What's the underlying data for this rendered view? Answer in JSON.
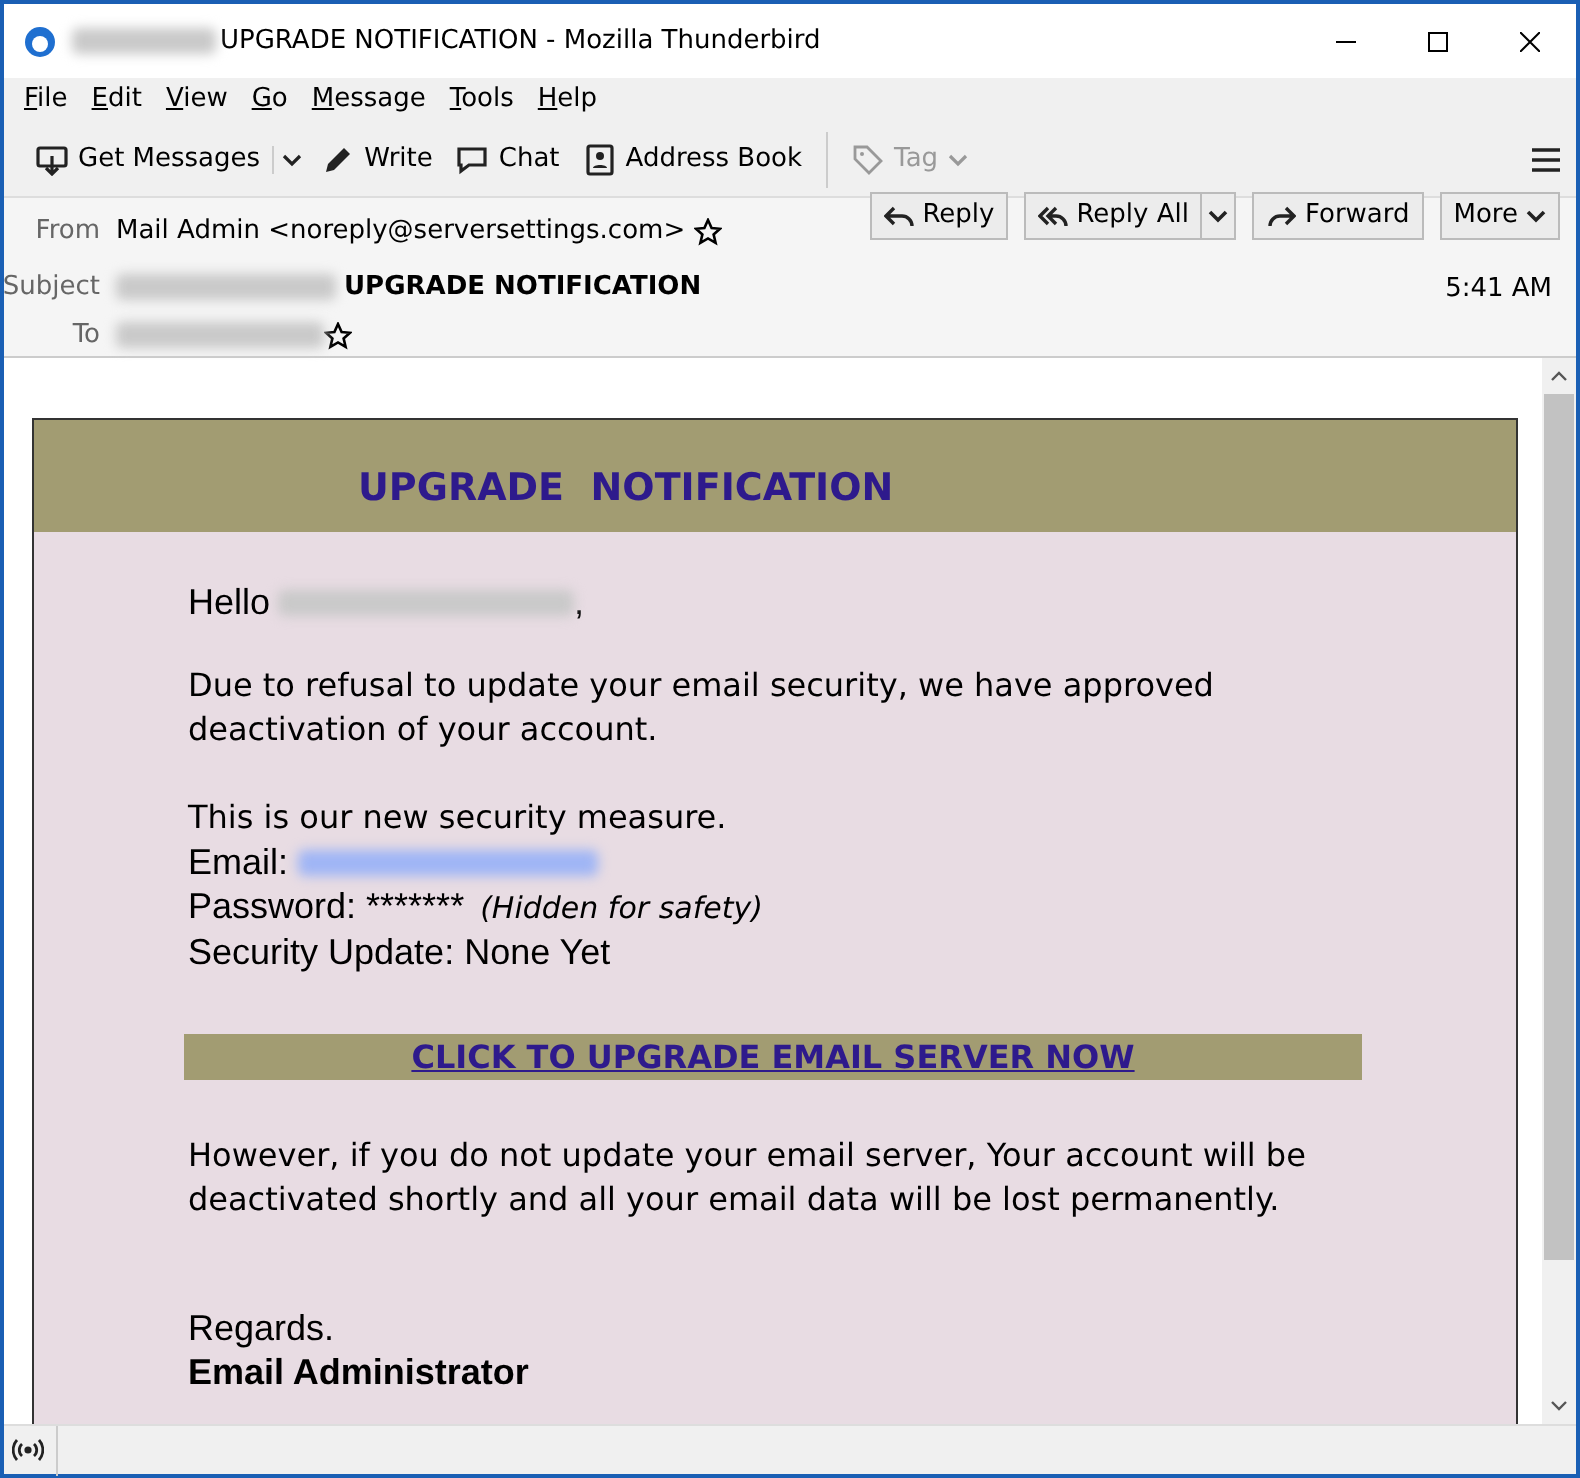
{
  "window": {
    "title": "UPGRADE NOTIFICATION - Mozilla Thunderbird"
  },
  "menu": [
    {
      "label": "File"
    },
    {
      "label": "Edit"
    },
    {
      "label": "View"
    },
    {
      "label": "Go"
    },
    {
      "label": "Message"
    },
    {
      "label": "Tools"
    },
    {
      "label": "Help"
    }
  ],
  "toolbar": [
    {
      "label": "Get Messages",
      "kind": "split",
      "disabled": false
    },
    {
      "label": "Write",
      "kind": "plain",
      "disabled": false
    },
    {
      "label": "Chat",
      "kind": "plain",
      "disabled": false
    },
    {
      "label": "Address Book",
      "kind": "plain",
      "disabled": false
    },
    {
      "label": "Tag",
      "kind": "dropdown",
      "disabled": true
    }
  ],
  "header": {
    "from": {
      "label": "From",
      "value": "Mail Admin <noreply@serversettings.com>"
    },
    "subject": {
      "label": "Subject",
      "value": "UPGRADE NOTIFICATION"
    },
    "to": {
      "label": "To"
    },
    "time": "5:41 AM",
    "actions": [
      {
        "label": "Reply",
        "kind": "plain"
      },
      {
        "label": "Reply All",
        "kind": "split"
      },
      {
        "label": "Forward",
        "kind": "plain"
      },
      {
        "label": "More",
        "kind": "dropdown"
      }
    ]
  },
  "email": {
    "banner_title": "UPGRADE  NOTIFICATION",
    "greeting": {
      "prefix": "Hello",
      "suffix": ","
    },
    "paragraph_1": "Due to refusal to update your email security, we have approved deactivation of your account.",
    "intro": "This is our new security measure.",
    "email_label": "Email:",
    "password_label": "Password: *******",
    "password_note": "(Hidden for safety)",
    "security_update": "Security Update: None Yet",
    "cta": "CLICK TO UPGRADE EMAIL SERVER NOW",
    "paragraph_2": "However, if you do not update your email server, Your account will be deactivated shortly and all your email data will be lost permanently.",
    "closing": "Regards.",
    "signature": "Email Administrator"
  }
}
